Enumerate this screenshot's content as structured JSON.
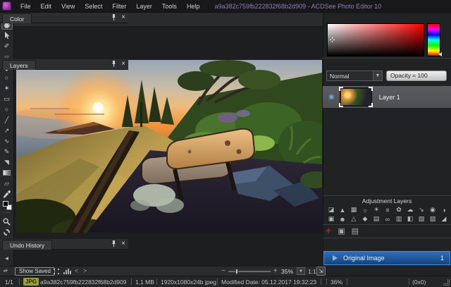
{
  "titlebar": {
    "title": "a9a382c759fb222832f68b2d909 - ACDSee Photo Editor 10",
    "menus": [
      "File",
      "Edit",
      "View",
      "Select",
      "Filter",
      "Layer",
      "Tools",
      "Help"
    ]
  },
  "left_toolbar": {
    "tools": [
      {
        "name": "pan-tool",
        "glyph": "@svg-hand",
        "selected": true
      },
      {
        "name": "select-arrow-tool",
        "glyph": "@svg-cursor"
      },
      {
        "name": "selection-pencil-tool",
        "glyph": "✐"
      },
      {
        "name": "marquee-tool",
        "glyph": "▫▫"
      },
      {
        "name": "move-tool",
        "glyph": "@svg-move"
      },
      {
        "name": "lasso-tool",
        "glyph": "○"
      },
      {
        "name": "magic-wand-tool",
        "glyph": "✶"
      },
      {
        "name": "rectangle-tool",
        "glyph": "▭"
      },
      {
        "name": "ellipse-tool",
        "glyph": "○"
      },
      {
        "name": "line-tool",
        "glyph": "╱"
      },
      {
        "name": "arrow-tool",
        "glyph": "↗"
      },
      {
        "name": "curve-tool",
        "glyph": "∿"
      },
      {
        "name": "pencil-tool",
        "glyph": "✎"
      },
      {
        "name": "brush-tool",
        "glyph": "◥"
      },
      {
        "name": "gradient-tool",
        "glyph": "@css-gradient"
      },
      {
        "name": "eraser-tool",
        "glyph": "▱"
      },
      {
        "name": "eyedropper-tool",
        "glyph": "@svg-dropper"
      },
      {
        "name": "color-swatches",
        "glyph": "@css-swatches"
      },
      {
        "name": "separator",
        "glyph": ""
      },
      {
        "name": "zoom-navigator-tool",
        "glyph": "@svg-zoom"
      },
      {
        "name": "settings-gear",
        "glyph": "@css-gear"
      },
      {
        "name": "collapse-arrows",
        "glyph": "◂"
      },
      {
        "name": "separator",
        "glyph": ""
      },
      {
        "name": "collapse-arrows-2",
        "glyph": "◂"
      }
    ]
  },
  "color_panel": {
    "title": "Color"
  },
  "layers_panel": {
    "title": "Layers",
    "blend_mode": "Normal",
    "opacity_label": "Opacity = 100",
    "layer_name": "Layer 1"
  },
  "adjustment": {
    "title": "Adjustment Layers",
    "rows": [
      [
        {
          "name": "exposure",
          "glyph": "◪"
        },
        {
          "name": "levels",
          "glyph": "▲"
        },
        {
          "name": "curves",
          "glyph": "▦"
        },
        {
          "name": "white-balance",
          "glyph": "☼"
        },
        {
          "name": "light-eq",
          "glyph": "☀"
        },
        {
          "name": "color-eq",
          "glyph": "≡"
        },
        {
          "name": "color-balance",
          "glyph": "✿"
        },
        {
          "name": "vibrance",
          "glyph": "☁"
        },
        {
          "name": "dodge-burn",
          "glyph": "↘"
        },
        {
          "name": "red-eye",
          "glyph": "◉"
        },
        {
          "name": "split-tone",
          "glyph": "◑"
        }
      ],
      [
        {
          "name": "vintage",
          "glyph": "▣"
        },
        {
          "name": "portrait",
          "glyph": "☻"
        },
        {
          "name": "sharpen",
          "glyph": "△"
        },
        {
          "name": "blur",
          "glyph": "◆"
        },
        {
          "name": "grain",
          "glyph": "▤"
        },
        {
          "name": "stereo",
          "glyph": "∞"
        },
        {
          "name": "detail",
          "glyph": "▥"
        },
        {
          "name": "gradient-map",
          "glyph": "◧"
        },
        {
          "name": "photo-effect",
          "glyph": "▧"
        },
        {
          "name": "texture",
          "glyph": "▨"
        },
        {
          "name": "histogram",
          "glyph": "◢"
        }
      ]
    ],
    "add_label": "+"
  },
  "undo_panel": {
    "title": "Undo History",
    "item": "Original Image",
    "count": "1",
    "coords": "(0x0)"
  },
  "bottom_toolbar": {
    "show_saved": "Show Saved",
    "prev": "<",
    "next": ">",
    "zoom_minus": "−",
    "zoom_plus": "+",
    "zoom_value": "35%",
    "dropdown_arrow": "▼",
    "one_to_one": "1:1",
    "fit_glyph": "⇲"
  },
  "statusbar": {
    "page": "1/1",
    "format_badge": "JPG",
    "filename": "a9a382c759fb222832f68b2d909",
    "filesize": "1,1 MB",
    "dimensions": "1920x1080x24b jpeg",
    "modified": "Modified Date: 05.12.2017 19:32:23",
    "progress": "36%"
  },
  "colors": {
    "accent_purple": "#8f7fae",
    "undo_selected_blue": "#2e6fbd",
    "jpg_badge_olive": "#9aa03c",
    "eye_blue": "#6aa6d8"
  }
}
